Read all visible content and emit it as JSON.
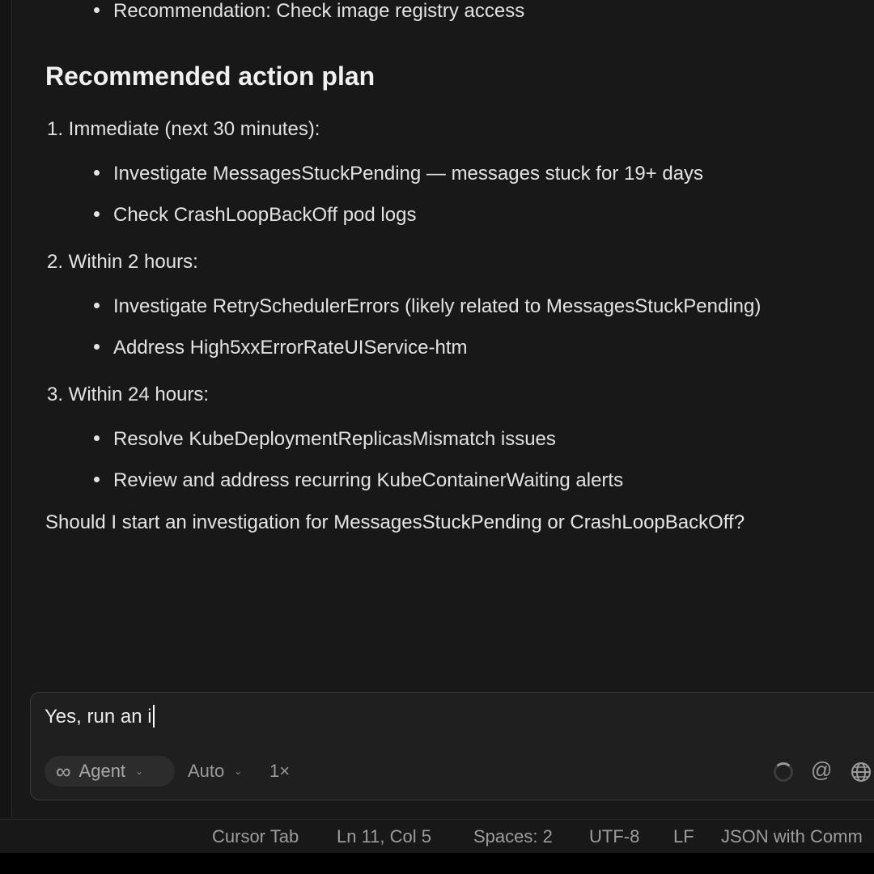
{
  "chat": {
    "top_bullet": "Recommendation: Check image registry access",
    "heading": "Recommended action plan",
    "steps": [
      {
        "label": "1. Immediate (next 30 minutes):",
        "bullets": [
          "Investigate MessagesStuckPending — messages stuck for 19+ days",
          "Check CrashLoopBackOff pod logs"
        ]
      },
      {
        "label": "2. Within 2 hours:",
        "bullets": [
          "Investigate RetrySchedulerErrors (likely related to MessagesStuckPending)",
          "Address High5xxErrorRateUIService-htm"
        ]
      },
      {
        "label": "3. Within 24 hours:",
        "bullets": [
          "Resolve KubeDeploymentReplicasMismatch issues",
          "Review and address recurring KubeContainerWaiting alerts"
        ]
      }
    ],
    "question": "Should I start an investigation for MessagesStuckPending or CrashLoopBackOff?"
  },
  "composer": {
    "input_value": "Yes, run an i",
    "mode_label": "Agent",
    "mode_icon": "infinity-icon",
    "model_label": "Auto",
    "multiplier_label": "1×",
    "icons": [
      "spinner-icon",
      "at-icon",
      "globe-icon"
    ]
  },
  "statusbar": {
    "cursor_tab": "Cursor Tab",
    "position": "Ln 11, Col 5",
    "spaces": "Spaces: 2",
    "encoding": "UTF-8",
    "eol": "LF",
    "language": "JSON with Comm"
  }
}
